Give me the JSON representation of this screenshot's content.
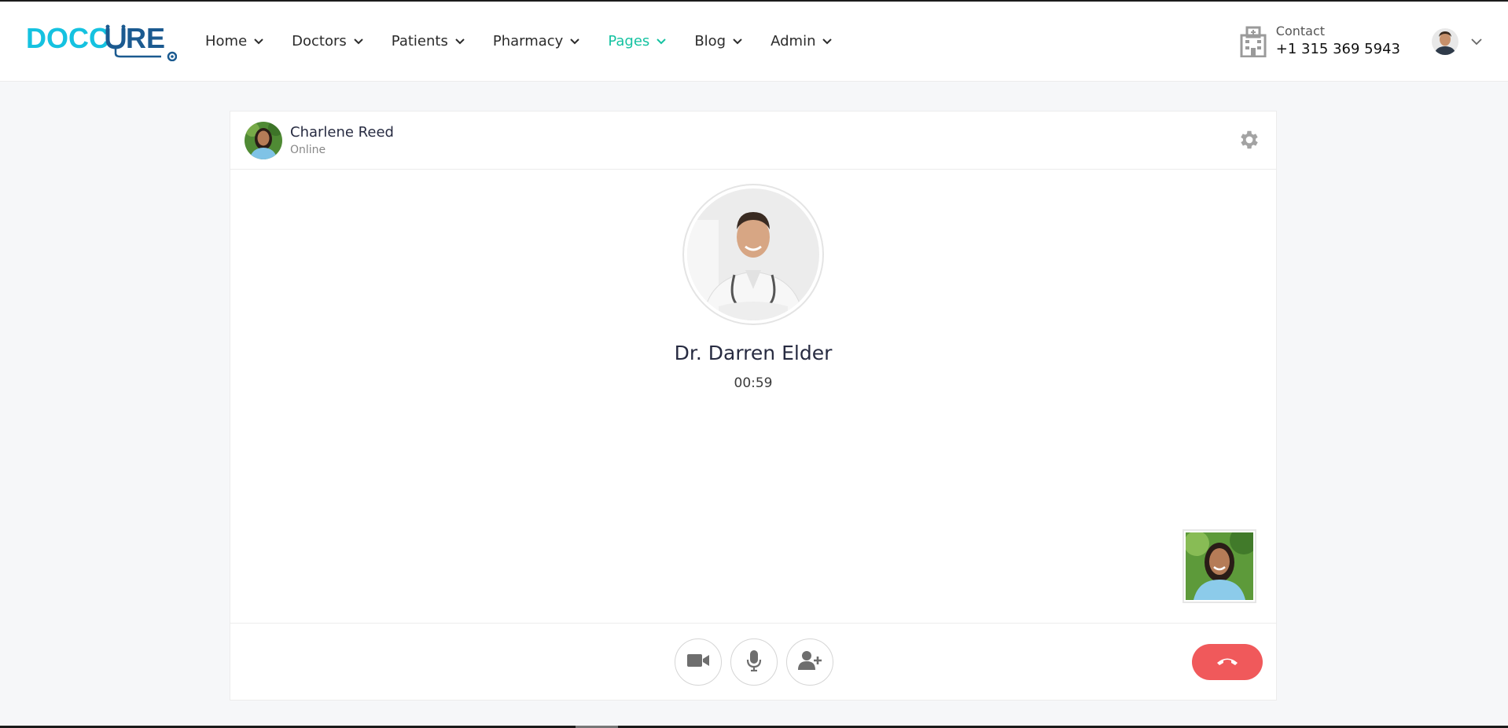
{
  "brand": {
    "name": "DOCCURE",
    "logo_prefix": "DOCC",
    "logo_suffix": "RE",
    "primary": "#15c2e0",
    "dark": "#1b5a90"
  },
  "nav": [
    {
      "label": "Home",
      "active": false
    },
    {
      "label": "Doctors",
      "active": false
    },
    {
      "label": "Patients",
      "active": false
    },
    {
      "label": "Pharmacy",
      "active": false
    },
    {
      "label": "Pages",
      "active": true
    },
    {
      "label": "Blog",
      "active": false
    },
    {
      "label": "Admin",
      "active": false
    }
  ],
  "contact": {
    "label": "Contact",
    "phone": "+1 315 369 5943",
    "icon": "hospital-icon"
  },
  "call": {
    "caller_name": "Charlene Reed",
    "caller_status": "Online",
    "doctor_name": "Dr. Darren Elder",
    "timer": "00:59",
    "controls": [
      "video-camera-icon",
      "microphone-icon",
      "add-user-icon"
    ],
    "end_call_color": "#f0595b"
  }
}
